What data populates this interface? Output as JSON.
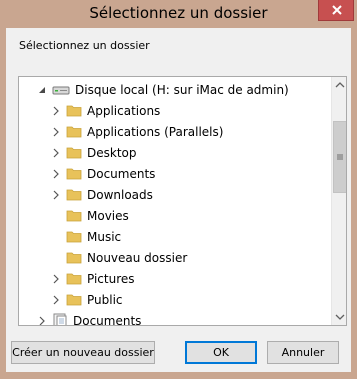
{
  "dialog": {
    "title": "Sélectionnez un dossier",
    "prompt": "Sélectionnez un dossier"
  },
  "tree": {
    "root": {
      "label": "Disque local (H: sur iMac de admin)",
      "icon": "drive-icon"
    },
    "items": [
      {
        "label": "Applications",
        "expandable": true
      },
      {
        "label": "Applications (Parallels)",
        "expandable": true
      },
      {
        "label": "Desktop",
        "expandable": true
      },
      {
        "label": "Documents",
        "expandable": true
      },
      {
        "label": "Downloads",
        "expandable": true
      },
      {
        "label": "Movies",
        "expandable": false
      },
      {
        "label": "Music",
        "expandable": false
      },
      {
        "label": "Nouveau dossier",
        "expandable": false
      },
      {
        "label": "Pictures",
        "expandable": true
      },
      {
        "label": "Public",
        "expandable": true
      }
    ],
    "last": {
      "label": "Documents",
      "icon": "documents-library-icon"
    }
  },
  "buttons": {
    "new_folder": "Créer un nouveau dossier",
    "ok": "OK",
    "cancel": "Annuler"
  },
  "colors": {
    "frame": "#c9a690",
    "close": "#c75050",
    "folder": "#e8c25a",
    "accent": "#0078d7"
  }
}
